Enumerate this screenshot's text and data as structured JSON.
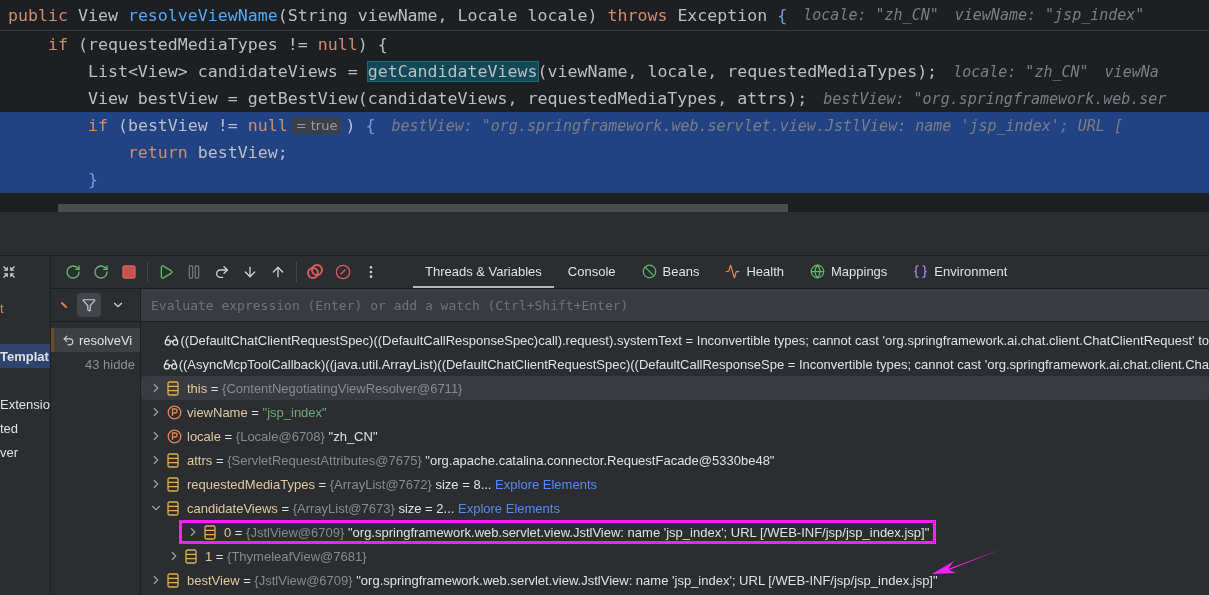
{
  "editor": {
    "sticky_line": [
      {
        "kind": "kw",
        "text": "public "
      },
      {
        "kind": "plain",
        "text": "View "
      },
      {
        "kind": "method",
        "text": "resolveViewName"
      },
      {
        "kind": "plain",
        "text": "(String viewName, Locale locale) "
      },
      {
        "kind": "kw",
        "text": "throws "
      },
      {
        "kind": "plain",
        "text": "Exception "
      },
      {
        "kind": "brace",
        "text": "{"
      },
      {
        "kind": "hint",
        "text": "locale: \"zh_CN\""
      },
      {
        "kind": "hint",
        "text": "viewName: \"jsp_index\""
      }
    ],
    "lines": [
      {
        "selected": false,
        "segments": [
          {
            "kind": "kw",
            "text": "    if "
          },
          {
            "kind": "plain",
            "text": "(requestedMediaTypes != "
          },
          {
            "kind": "kw",
            "text": "null"
          },
          {
            "kind": "plain",
            "text": ") {"
          }
        ]
      },
      {
        "selected": false,
        "segments": [
          {
            "kind": "plain",
            "text": "        List<View> candidateViews = "
          },
          {
            "kind": "match",
            "text": "getCandidateViews"
          },
          {
            "kind": "plain",
            "text": "(viewName, locale, requestedMediaTypes);"
          },
          {
            "kind": "hint",
            "text": "locale: \"zh_CN\""
          },
          {
            "kind": "hint",
            "text": "viewNa"
          }
        ]
      },
      {
        "selected": false,
        "segments": [
          {
            "kind": "plain",
            "text": "        View bestView = getBestView(candidateViews, requestedMediaTypes, attrs);"
          },
          {
            "kind": "hint",
            "text": "bestView: \"org.springframework.web.ser"
          }
        ]
      },
      {
        "selected": true,
        "segments": [
          {
            "kind": "kw",
            "text": "        if "
          },
          {
            "kind": "plain",
            "text": "(bestView != "
          },
          {
            "kind": "kw",
            "text": "null"
          },
          {
            "kind": "badge",
            "text": "= true"
          },
          {
            "kind": "plain",
            "text": ") "
          },
          {
            "kind": "brace",
            "text": "{"
          },
          {
            "kind": "hint",
            "text": "bestView: \"org.springframework.web.servlet.view.JstlView: name 'jsp_index'; URL ["
          }
        ]
      },
      {
        "selected": true,
        "segments": [
          {
            "kind": "kw",
            "text": "            return "
          },
          {
            "kind": "plain",
            "text": "bestView;"
          }
        ]
      },
      {
        "selected": true,
        "segments": [
          {
            "kind": "brace",
            "text": "        }"
          }
        ]
      }
    ]
  },
  "side_strip": [
    {
      "text": "t",
      "selected": false,
      "kind": "mark"
    },
    {
      "text": "Templat",
      "selected": true,
      "kind": "item"
    },
    {
      "text": "Extensio",
      "selected": false,
      "kind": "item"
    },
    {
      "text": "ted",
      "selected": false,
      "kind": "item"
    },
    {
      "text": "ver",
      "selected": false,
      "kind": "item"
    }
  ],
  "toolbar": {
    "tools": [
      {
        "kind": "rerun"
      },
      {
        "kind": "rerun-debug"
      },
      {
        "kind": "stop"
      },
      {
        "kind": "resume"
      },
      {
        "kind": "pause",
        "disabled": true
      },
      {
        "kind": "step-over"
      },
      {
        "kind": "step-into"
      },
      {
        "kind": "step-out"
      },
      {
        "kind": "breakpoints"
      },
      {
        "kind": "mute"
      },
      {
        "kind": "more"
      }
    ],
    "tabs": [
      {
        "label": "Threads & Variables",
        "selected": true,
        "kind": "none"
      },
      {
        "label": "Console",
        "selected": false,
        "kind": "none"
      },
      {
        "label": "Beans",
        "selected": false,
        "kind": "beans"
      },
      {
        "label": "Health",
        "selected": false,
        "kind": "health"
      },
      {
        "label": "Mappings",
        "selected": false,
        "kind": "mappings"
      },
      {
        "label": "Environment",
        "selected": false,
        "kind": "environment"
      }
    ]
  },
  "evaluate": {
    "placeholder": "Evaluate expression (Enter) or add a watch (Ctrl+Shift+Enter)"
  },
  "frames": [
    {
      "text": "resolveVi",
      "selected": true,
      "kind": "frame"
    },
    {
      "text": "43 hidde",
      "selected": false,
      "kind": "hidden"
    }
  ],
  "variables": [
    {
      "kind": "watch",
      "name": "((DefaultChatClientRequestSpec)((DefaultCallResponseSpec)call).request).systemText",
      "operator": "=",
      "value": "Inconvertible types; cannot cast 'org.springframework.ai.chat.client.ChatClientRequest' to",
      "selected": false,
      "boxed": false
    },
    {
      "kind": "watch",
      "name": "((AsyncMcpToolCallback)((java.util.ArrayList)((DefaultChatClientRequestSpec)((DefaultCallResponseSpe",
      "operator": "=",
      "value": "Inconvertible types; cannot cast 'org.springframework.ai.chat.client.Cha",
      "selected": false,
      "boxed": false
    },
    {
      "kind": "field",
      "name": "this",
      "operator": "=",
      "type": "{ContentNegotiatingViewResolver@6711}",
      "selected": true,
      "boxed": false,
      "expanded": false
    },
    {
      "kind": "param",
      "name": "viewName",
      "operator": "=",
      "string": "\"jsp_index\"",
      "selected": false,
      "boxed": false,
      "expanded": false
    },
    {
      "kind": "param",
      "name": "locale",
      "operator": "=",
      "type": "{Locale@6708}",
      "value": "\"zh_CN\"",
      "selected": false,
      "boxed": false,
      "expanded": false
    },
    {
      "kind": "field",
      "name": "attrs",
      "operator": "=",
      "type": "{ServletRequestAttributes@7675}",
      "value": "\"org.apache.catalina.connector.RequestFacade@5330be48\"",
      "selected": false,
      "boxed": false,
      "expanded": false
    },
    {
      "kind": "field",
      "name": "requestedMediaTypes",
      "operator": "=",
      "type": "{ArrayList@7672}",
      "value": "size = 8...",
      "link": "Explore Elements",
      "selected": false,
      "boxed": false,
      "expanded": false
    },
    {
      "kind": "field",
      "name": "candidateViews",
      "operator": "=",
      "type": "{ArrayList@7673}",
      "value": "size = 2...",
      "link": "Explore Elements",
      "selected": false,
      "boxed": false,
      "expanded": true,
      "children": [
        {
          "kind": "field",
          "name": "0",
          "operator": "=",
          "type": "{JstlView@6709}",
          "value": "\"org.springframework.web.servlet.view.JstlView: name 'jsp_index'; URL [/WEB-INF/jsp/jsp_index.jsp]\"",
          "selected": false,
          "boxed": true,
          "expanded": false
        },
        {
          "kind": "field",
          "name": "1",
          "operator": "=",
          "type": "{ThymeleafView@7681}",
          "selected": false,
          "boxed": false,
          "expanded": false
        }
      ]
    },
    {
      "kind": "field",
      "name": "bestView",
      "operator": "=",
      "type": "{JstlView@6709}",
      "value": "\"org.springframework.web.servlet.view.JstlView: name 'jsp_index'; URL [/WEB-INF/jsp/jsp_index.jsp]\"",
      "selected": false,
      "boxed": false,
      "expanded": false,
      "pointer": true
    }
  ]
}
